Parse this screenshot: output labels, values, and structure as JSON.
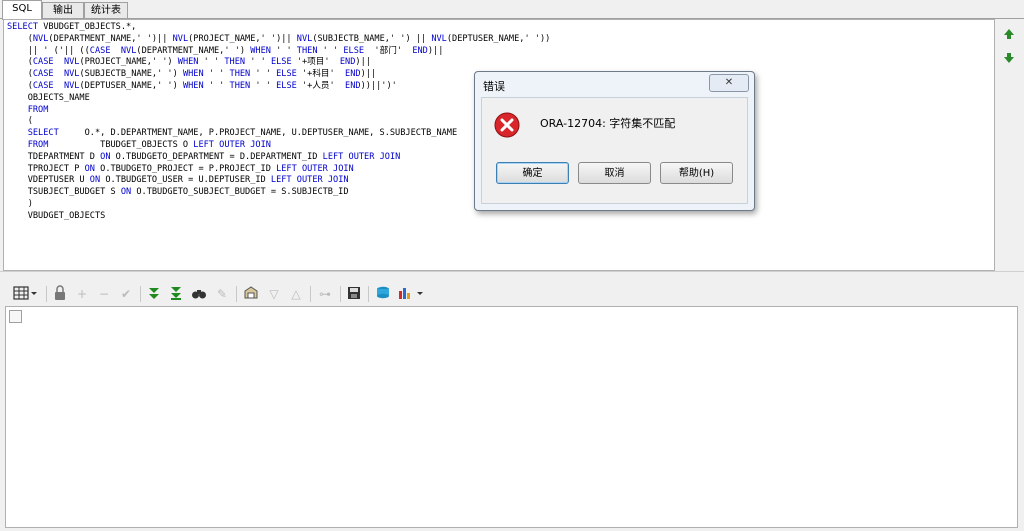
{
  "tabs": [
    {
      "label": "SQL"
    },
    {
      "label": "输出"
    },
    {
      "label": "统计表"
    }
  ],
  "sql_lines": [
    "SELECT VBUDGET_OBJECTS.*,",
    "    (NVL(DEPARTMENT_NAME,' ')|| NVL(PROJECT_NAME,' ')|| NVL(SUBJECTB_NAME,' ') || NVL(DEPTUSER_NAME,' '))",
    "    || ' ('|| ((CASE  NVL(DEPARTMENT_NAME,' ') WHEN ' ' THEN ' ' ELSE  '部门'  END)||",
    "    (CASE  NVL(PROJECT_NAME,' ') WHEN ' ' THEN ' ' ELSE '+项目'  END)||",
    "    (CASE  NVL(SUBJECTB_NAME,' ') WHEN ' ' THEN ' ' ELSE '+科目'  END)||",
    "    (CASE  NVL(DEPTUSER_NAME,' ') WHEN ' ' THEN ' ' ELSE '+人员'  END))||')'",
    "    OBJECTS_NAME",
    "    FROM",
    "    (",
    "    SELECT     O.*, D.DEPARTMENT_NAME, P.PROJECT_NAME, U.DEPTUSER_NAME, S.SUBJECTB_NAME",
    "    FROM          TBUDGET_OBJECTS O LEFT OUTER JOIN",
    "    TDEPARTMENT D ON O.TBUDGETO_DEPARTMENT = D.DEPARTMENT_ID LEFT OUTER JOIN",
    "    TPROJECT P ON O.TBUDGETO_PROJECT = P.PROJECT_ID LEFT OUTER JOIN",
    "    VDEPTUSER U ON O.TBUDGETO_USER = U.DEPTUSER_ID LEFT OUTER JOIN",
    "    TSUBJECT_BUDGET S ON O.TBUDGETO_SUBJECT_BUDGET = S.SUBJECTB_ID",
    "    )",
    "    VBUDGET_OBJECTS"
  ],
  "keywords": [
    "SELECT",
    "NVL",
    "CASE",
    "WHEN",
    "THEN",
    "ELSE",
    "END",
    "FROM",
    "LEFT",
    "OUTER",
    "JOIN",
    "ON"
  ],
  "toolbar": {
    "icons": [
      "grid-view-icon",
      "lock-icon",
      "add-icon",
      "remove-icon",
      "check-icon",
      "fetch-next-icon",
      "fetch-all-icon",
      "find-icon",
      "clear-icon",
      "query-icon",
      "arrow-down-icon",
      "arrow-up-icon",
      "link-icon",
      "save-icon",
      "export-icon",
      "chart-icon"
    ]
  },
  "dialog": {
    "title": "错误",
    "close": "✕",
    "message": "ORA-12704: 字符集不匹配",
    "ok_label": "确定",
    "cancel_label": "取消",
    "help_label": "帮助(H)"
  },
  "colors": {
    "keyword": "#0000cc",
    "error_icon": "#d9262b",
    "arrow_green": "#2a8a2a"
  }
}
